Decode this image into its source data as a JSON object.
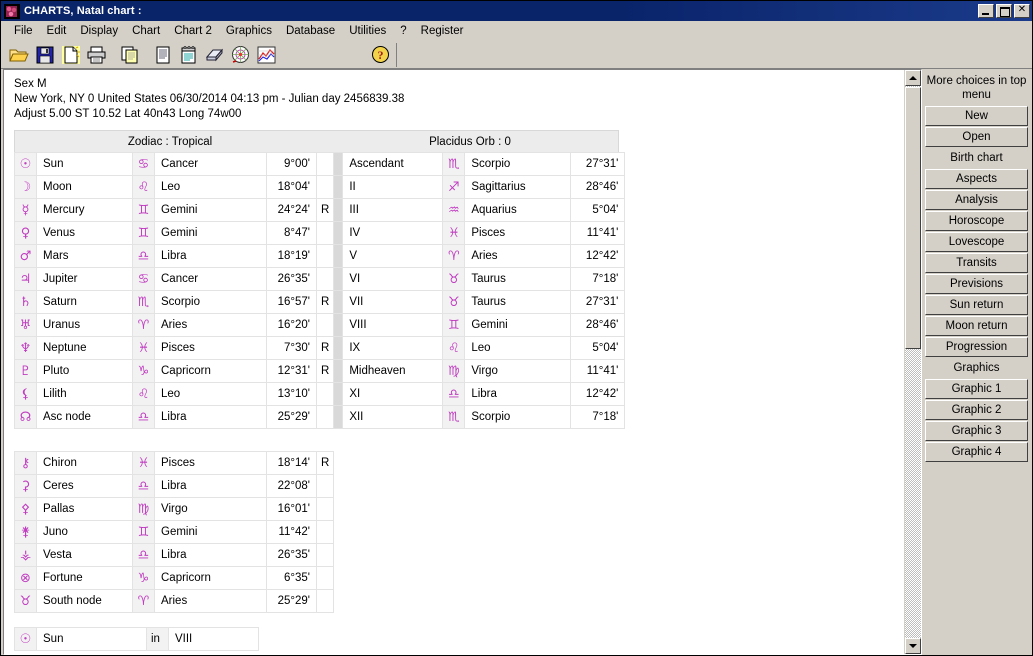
{
  "window": {
    "title": "CHARTS, Natal chart :",
    "minimize_label": "_",
    "maximize_label": "□",
    "close_label": "✕"
  },
  "menubar": {
    "items": [
      {
        "label": "File"
      },
      {
        "label": "Edit"
      },
      {
        "label": "Display"
      },
      {
        "label": "Chart"
      },
      {
        "label": "Chart 2"
      },
      {
        "label": "Graphics"
      },
      {
        "label": "Database"
      },
      {
        "label": "Utilities"
      },
      {
        "label": "?"
      },
      {
        "label": "Register"
      }
    ]
  },
  "toolbar": {
    "buttons": [
      {
        "name": "open-folder-icon"
      },
      {
        "name": "save-floppy-icon"
      },
      {
        "name": "new-document-icon"
      },
      {
        "name": "print-icon"
      },
      {
        "name": "copy-icon"
      },
      {
        "name": "document-icon"
      },
      {
        "name": "notepad-icon"
      },
      {
        "name": "eraser-icon"
      },
      {
        "name": "chart-wheel-icon"
      },
      {
        "name": "graph-icon"
      },
      {
        "name": "help-question-icon"
      }
    ]
  },
  "info": {
    "line1": "Sex M",
    "line2": "New York, NY 0 United States 06/30/2014 04:13 pm - Julian day 2456839.38",
    "line3": "Adjust 5.00 ST 10.52 Lat 40n43 Long 74w00"
  },
  "table_headers": {
    "zodiac": "Zodiac : Tropical",
    "houses": "Placidus Orb : 0"
  },
  "planets": [
    {
      "symbol": "☉",
      "name": "Sun",
      "sign_symbol": "♋",
      "sign": "Cancer",
      "degree": "9°00'",
      "retro": ""
    },
    {
      "symbol": "☽",
      "name": "Moon",
      "sign_symbol": "♌",
      "sign": "Leo",
      "degree": "18°04'",
      "retro": ""
    },
    {
      "symbol": "☿",
      "name": "Mercury",
      "sign_symbol": "♊",
      "sign": "Gemini",
      "degree": "24°24'",
      "retro": "R"
    },
    {
      "symbol": "♀",
      "name": "Venus",
      "sign_symbol": "♊",
      "sign": "Gemini",
      "degree": "8°47'",
      "retro": ""
    },
    {
      "symbol": "♂",
      "name": "Mars",
      "sign_symbol": "♎",
      "sign": "Libra",
      "degree": "18°19'",
      "retro": ""
    },
    {
      "symbol": "♃",
      "name": "Jupiter",
      "sign_symbol": "♋",
      "sign": "Cancer",
      "degree": "26°35'",
      "retro": ""
    },
    {
      "symbol": "♄",
      "name": "Saturn",
      "sign_symbol": "♏",
      "sign": "Scorpio",
      "degree": "16°57'",
      "retro": "R"
    },
    {
      "symbol": "♅",
      "name": "Uranus",
      "sign_symbol": "♈",
      "sign": "Aries",
      "degree": "16°20'",
      "retro": ""
    },
    {
      "symbol": "♆",
      "name": "Neptune",
      "sign_symbol": "♓",
      "sign": "Pisces",
      "degree": "7°30'",
      "retro": "R"
    },
    {
      "symbol": "♇",
      "name": "Pluto",
      "sign_symbol": "♑",
      "sign": "Capricorn",
      "degree": "12°31'",
      "retro": "R"
    },
    {
      "symbol": "⚸",
      "name": "Lilith",
      "sign_symbol": "♌",
      "sign": "Leo",
      "degree": "13°10'",
      "retro": ""
    },
    {
      "symbol": "☊",
      "name": "Asc node",
      "sign_symbol": "♎",
      "sign": "Libra",
      "degree": "25°29'",
      "retro": ""
    }
  ],
  "houses": [
    {
      "name": "Ascendant",
      "sign_symbol": "♏",
      "sign": "Scorpio",
      "degree": "27°31'"
    },
    {
      "name": "II",
      "sign_symbol": "♐",
      "sign": "Sagittarius",
      "degree": "28°46'"
    },
    {
      "name": "III",
      "sign_symbol": "♒",
      "sign": "Aquarius",
      "degree": "5°04'"
    },
    {
      "name": "IV",
      "sign_symbol": "♓",
      "sign": "Pisces",
      "degree": "11°41'"
    },
    {
      "name": "V",
      "sign_symbol": "♈",
      "sign": "Aries",
      "degree": "12°42'"
    },
    {
      "name": "VI",
      "sign_symbol": "♉",
      "sign": "Taurus",
      "degree": "7°18'"
    },
    {
      "name": "VII",
      "sign_symbol": "♉",
      "sign": "Taurus",
      "degree": "27°31'"
    },
    {
      "name": "VIII",
      "sign_symbol": "♊",
      "sign": "Gemini",
      "degree": "28°46'"
    },
    {
      "name": "IX",
      "sign_symbol": "♌",
      "sign": "Leo",
      "degree": "5°04'"
    },
    {
      "name": "Midheaven",
      "sign_symbol": "♍",
      "sign": "Virgo",
      "degree": "11°41'"
    },
    {
      "name": "XI",
      "sign_symbol": "♎",
      "sign": "Libra",
      "degree": "12°42'"
    },
    {
      "name": "XII",
      "sign_symbol": "♏",
      "sign": "Scorpio",
      "degree": "7°18'"
    }
  ],
  "asteroids": [
    {
      "symbol": "⚷",
      "name": "Chiron",
      "sign_symbol": "♓",
      "sign": "Pisces",
      "degree": "18°14'",
      "retro": "R"
    },
    {
      "symbol": "⚳",
      "name": "Ceres",
      "sign_symbol": "♎",
      "sign": "Libra",
      "degree": "22°08'",
      "retro": ""
    },
    {
      "symbol": "⚴",
      "name": "Pallas",
      "sign_symbol": "♍",
      "sign": "Virgo",
      "degree": "16°01'",
      "retro": ""
    },
    {
      "symbol": "⚵",
      "name": "Juno",
      "sign_symbol": "♊",
      "sign": "Gemini",
      "degree": "11°42'",
      "retro": ""
    },
    {
      "symbol": "⚶",
      "name": "Vesta",
      "sign_symbol": "♎",
      "sign": "Libra",
      "degree": "26°35'",
      "retro": ""
    },
    {
      "symbol": "⊗",
      "name": "Fortune",
      "sign_symbol": "♑",
      "sign": "Capricorn",
      "degree": "6°35'",
      "retro": ""
    },
    {
      "symbol": "♉",
      "name": "South node",
      "sign_symbol": "♈",
      "sign": "Aries",
      "degree": "25°29'",
      "retro": ""
    }
  ],
  "aspect_rows": [
    {
      "symbol": "☉",
      "name": "Sun",
      "relation": "in",
      "house": "VIII"
    }
  ],
  "sidebar": {
    "header": "More choices in top menu",
    "group1_buttons": [
      {
        "label": "New"
      },
      {
        "label": "Open"
      }
    ],
    "group2_label": "Birth chart",
    "group2_buttons": [
      {
        "label": "Aspects"
      },
      {
        "label": "Analysis"
      },
      {
        "label": "Horoscope"
      },
      {
        "label": "Lovescope"
      },
      {
        "label": "Transits"
      },
      {
        "label": "Previsions"
      },
      {
        "label": "Sun return"
      },
      {
        "label": "Moon return"
      },
      {
        "label": "Progression"
      }
    ],
    "group3_label": "Graphics",
    "group3_buttons": [
      {
        "label": "Graphic 1"
      },
      {
        "label": "Graphic 2"
      },
      {
        "label": "Graphic 3"
      },
      {
        "label": "Graphic 4"
      }
    ]
  },
  "colors": {
    "titlebar": "#0a246a",
    "symbol": "#c03cc0",
    "face": "#d4d0c8"
  }
}
